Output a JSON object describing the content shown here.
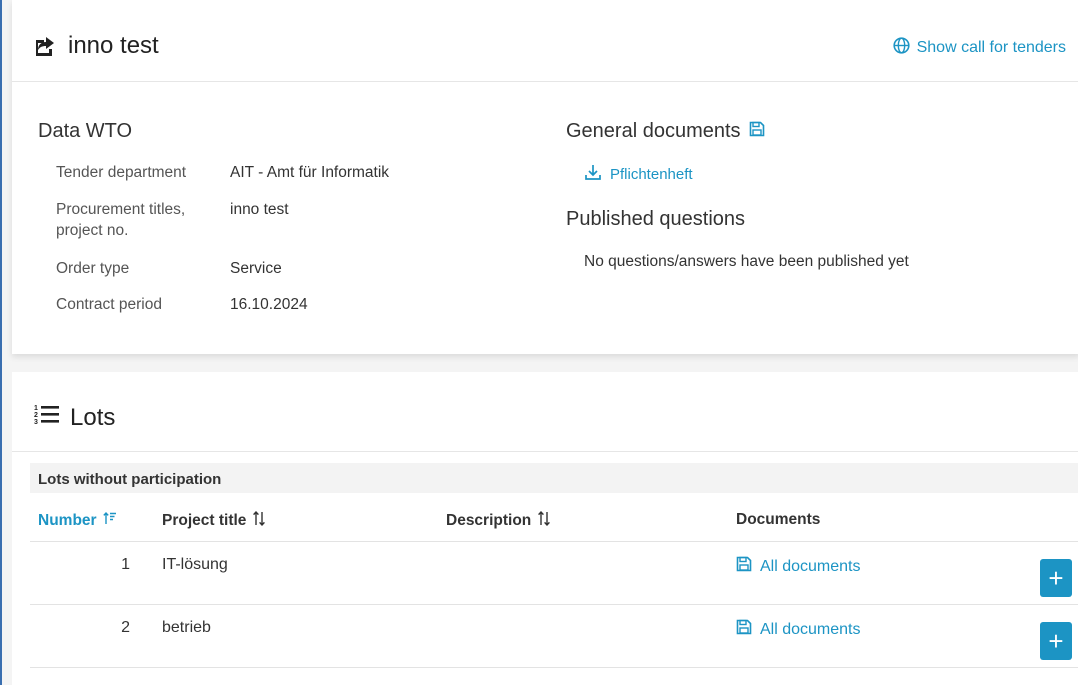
{
  "header": {
    "title": "inno test",
    "show_link": "Show call for tenders"
  },
  "data_wto": {
    "heading": "Data WTO",
    "fields": [
      {
        "label": "Tender department",
        "value": "AIT - Amt für Informatik"
      },
      {
        "label": "Procurement titles, project no.",
        "value": "inno test"
      },
      {
        "label": "Order type",
        "value": "Service"
      },
      {
        "label": "Contract period",
        "value": "16.10.2024"
      }
    ]
  },
  "general_documents": {
    "heading": "General documents",
    "files": [
      "Pflichtenheft"
    ]
  },
  "published_questions": {
    "heading": "Published questions",
    "empty_text": "No questions/answers have been published yet"
  },
  "lots": {
    "heading": "Lots",
    "group_label": "Lots without participation",
    "columns": {
      "number": "Number",
      "project_title": "Project title",
      "description": "Description",
      "documents": "Documents"
    },
    "rows": [
      {
        "number": "1",
        "project_title": "IT-lösung",
        "description": "",
        "documents": "All documents"
      },
      {
        "number": "2",
        "project_title": "betrieb",
        "description": "",
        "documents": "All documents"
      }
    ]
  },
  "colors": {
    "accent": "#1c94c4",
    "text": "#333333",
    "group_row_bg": "#f3f3f3"
  },
  "icons": {
    "title": "share-icon",
    "show_link": "globe-icon",
    "general_documents": "floppy-disk-icon",
    "document_download": "download-icon",
    "lots": "ordered-list-icon",
    "sort_ascending": "sort-ascending-icon",
    "sort": "sort-icon",
    "row_documents": "floppy-disk-icon",
    "add": "plus-icon"
  }
}
